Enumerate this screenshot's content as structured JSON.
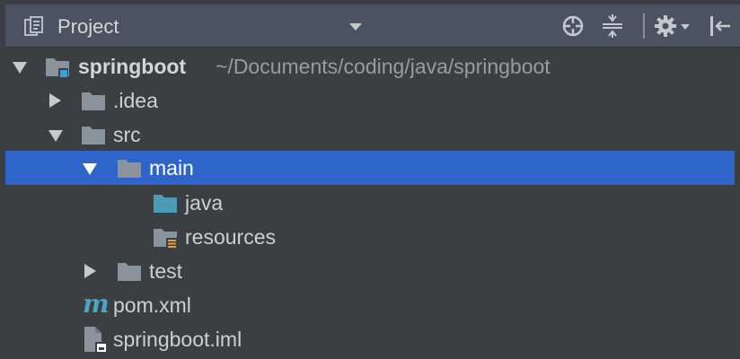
{
  "header": {
    "title": "Project",
    "icons": [
      "project-icon",
      "locate-icon",
      "collapse-all-icon",
      "settings-gear-icon",
      "hide-panel-icon"
    ]
  },
  "tree": {
    "root": {
      "label": "springboot",
      "path": "~/Documents/coding/java/springboot",
      "expanded": true
    },
    "idea": {
      "label": ".idea",
      "expanded": false
    },
    "src": {
      "label": "src",
      "expanded": true
    },
    "main": {
      "label": "main",
      "expanded": true,
      "selected": true
    },
    "java": {
      "label": "java"
    },
    "resources": {
      "label": "resources"
    },
    "test": {
      "label": "test",
      "expanded": false
    },
    "pom": {
      "label": "pom.xml",
      "icon": "maven-icon"
    },
    "iml": {
      "label": "springboot.iml",
      "icon": "module-file-icon"
    }
  },
  "colors": {
    "background": "#3c3f41",
    "header": "#4b5262",
    "selection": "#2f65ca",
    "folder": "#8b939d",
    "source-folder": "#4a9bb5",
    "module-badge": "#3aa0d8",
    "resource-badge": "#e0a030"
  }
}
